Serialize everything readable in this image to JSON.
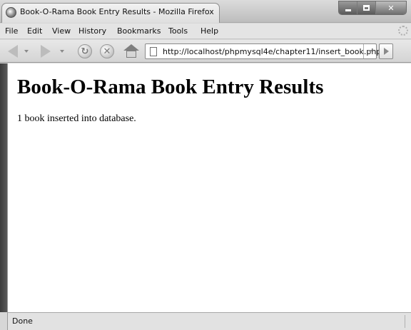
{
  "window": {
    "title": "Book-O-Rama Book Entry Results - Mozilla Firefox"
  },
  "menu": {
    "items": [
      {
        "label": "File"
      },
      {
        "label": "Edit"
      },
      {
        "label": "View"
      },
      {
        "label": "History"
      },
      {
        "label": "Bookmarks"
      },
      {
        "label": "Tools"
      },
      {
        "label": "Help"
      }
    ]
  },
  "navbar": {
    "url": "http://localhost/phpmysql4e/chapter11/insert_book.php"
  },
  "page": {
    "heading": "Book-O-Rama Book Entry Results",
    "message": "1 book inserted into database."
  },
  "status": {
    "text": "Done"
  },
  "icons": {
    "app": "firefox-icon",
    "back": "back-arrow-icon",
    "forward": "forward-arrow-icon",
    "reload": "reload-icon",
    "stop": "stop-icon",
    "home": "home-icon",
    "page": "page-icon",
    "throbber": "throbber-icon"
  }
}
